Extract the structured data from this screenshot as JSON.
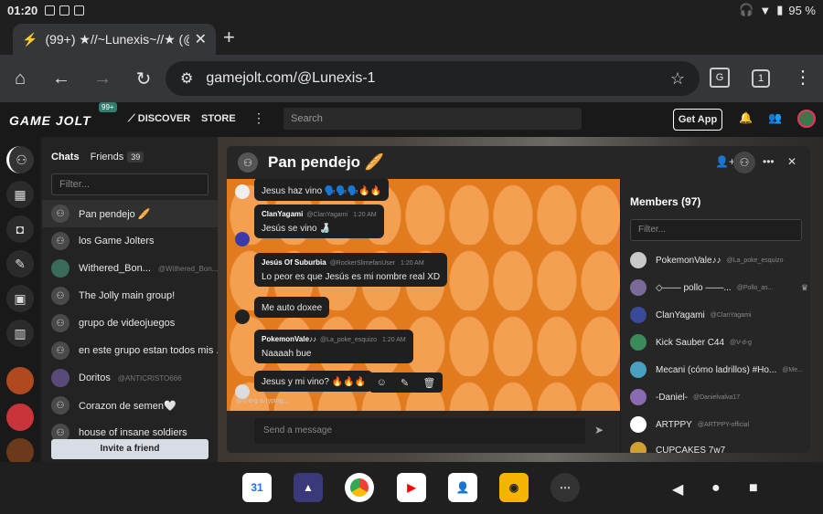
{
  "status_bar": {
    "time": "01:20",
    "battery": "95 %"
  },
  "browser": {
    "tab_title": "(99+) ★//~Lunexis~//★ (@Lu",
    "url": "gamejolt.com/@Lunexis-1",
    "tab_count": "1"
  },
  "gamejolt": {
    "logo": "GAME JOLT",
    "notif_badge": "99+",
    "nav_discover": "DISCOVER",
    "nav_store": "STORE",
    "search_placeholder": "Search",
    "get_app": "Get App"
  },
  "chats": {
    "tab_chats": "Chats",
    "tab_friends": "Friends",
    "friends_count": "39",
    "filter_placeholder": "Filter...",
    "items": [
      {
        "name": "Pan pendejo 🥖",
        "sub": ""
      },
      {
        "name": "los Game Jolters",
        "sub": ""
      },
      {
        "name": "Withered_Bon...",
        "sub": "@Withered_Bon..."
      },
      {
        "name": "The Jolly main group!",
        "sub": ""
      },
      {
        "name": "grupo de videojuegos",
        "sub": ""
      },
      {
        "name": "en este grupo estan todos mis ...",
        "sub": ""
      },
      {
        "name": "Doritos",
        "sub": "@ANTICRISTO666"
      },
      {
        "name": "Corazon de semen🤍",
        "sub": ""
      },
      {
        "name": "house of insane soldiers",
        "sub": ""
      }
    ],
    "invite_button": "Invite a friend"
  },
  "chat_window": {
    "title": "Pan pendejo 🥖",
    "messages": [
      {
        "author": "",
        "handle": "",
        "time": "",
        "body": "Jesus haz vino 🗣️🗣️🗣️🔥🔥"
      },
      {
        "author": "ClanYagami",
        "handle": "@ClanYagami",
        "time": "1:20 AM",
        "body": "Jesús se vino 🍶"
      },
      {
        "author": "Jesús Of Suburbia",
        "handle": "@RockerSlimefanUser",
        "time": "1:20 AM",
        "body": "Lo peor es que Jesús es mi nombre real XD"
      },
      {
        "author": "",
        "handle": "",
        "time": "",
        "body": "Me auto doxee"
      },
      {
        "author": "PokemonVale♪♪",
        "handle": "@La_poke_esquizo",
        "time": "1:20 AM",
        "body": "Naaaah bue"
      },
      {
        "author": "",
        "handle": "",
        "time": "",
        "body": "Jesus y mi vino? 🔥🔥🔥"
      }
    ],
    "typing": "@V-d-g is typing...",
    "compose_placeholder": "Send a message"
  },
  "members": {
    "title": "Members (97)",
    "filter_placeholder": "Filter...",
    "list": [
      {
        "name": "PokemonVale♪♪",
        "handle": "@La_poke_esquizo",
        "color": "#c9c9c9"
      },
      {
        "name": "◇—— pollo ——...",
        "handle": "@Pollo_as...",
        "color": "#7a6a9a"
      },
      {
        "name": "ClanYagami",
        "handle": "@ClanYagami",
        "color": "#3a4a9a"
      },
      {
        "name": "Kick Sauber C44",
        "handle": "@V-d-g",
        "color": "#3a8a5a"
      },
      {
        "name": "Mecani (cómo ladrillos) #Ho...",
        "handle": "@Me...",
        "color": "#4aa0c0"
      },
      {
        "name": "-Daniel-",
        "handle": "@Danielvalva17",
        "color": "#8a6ab0"
      },
      {
        "name": "ARTPPY",
        "handle": "@ARTPPY-official",
        "color": "#ffffff"
      },
      {
        "name": "CUPCAKES 7w7",
        "handle": "",
        "color": "#d0a030"
      }
    ]
  },
  "dock": {
    "calendar": "31"
  }
}
